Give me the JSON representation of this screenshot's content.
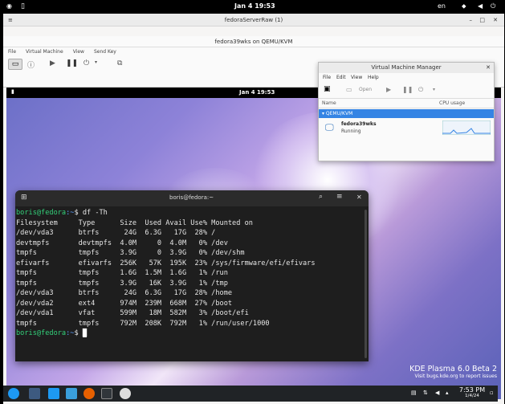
{
  "gnome_bar": {
    "clock": "Jan 4  19:53",
    "title": "fedoraServerRaw (1)",
    "lang": "en"
  },
  "viewer": {
    "window_title": "fedora39wks on QEMU/KVM",
    "menu": [
      "File",
      "Virtual Machine",
      "View",
      "Send Key"
    ]
  },
  "guest": {
    "clock": "Jan 4  19:53"
  },
  "vmm": {
    "title": "Virtual Machine Manager",
    "menu": [
      "File",
      "Edit",
      "View",
      "Help"
    ],
    "open_label": "Open",
    "col_name": "Name",
    "col_cpu": "CPU usage",
    "group": "QEMU/KVM",
    "vm_name": "fedora39wks",
    "vm_status": "Running"
  },
  "terminal": {
    "title": "boris@fedora:~",
    "prompt_user": "boris@fedora",
    "prompt_path": ":~",
    "prompt_symbol": "$ ",
    "command": "df -Th",
    "header": "Filesystem     Type      Size  Used Avail Use% Mounted on",
    "rows": [
      "/dev/vda3      btrfs      24G  6.3G   17G  28% /",
      "devtmpfs       devtmpfs  4.0M     0  4.0M   0% /dev",
      "tmpfs          tmpfs     3.9G     0  3.9G   0% /dev/shm",
      "efivarfs       efivarfs  256K   57K  195K  23% /sys/firmware/efi/efivars",
      "tmpfs          tmpfs     1.6G  1.5M  1.6G   1% /run",
      "tmpfs          tmpfs     3.9G   16K  3.9G   1% /tmp",
      "/dev/vda3      btrfs      24G  6.3G   17G  28% /home",
      "/dev/vda2      ext4      974M  239M  668M  27% /boot",
      "/dev/vda1      vfat      599M   18M  582M   3% /boot/efi",
      "tmpfs          tmpfs     792M  208K  792M   1% /run/user/1000"
    ]
  },
  "kde": {
    "title": "KDE Plasma 6.0 Beta 2",
    "subtitle": "Visit bugs.kde.org to report issues"
  },
  "taskbar": {
    "time": "7:53 PM",
    "date": "1/4/24"
  },
  "colors": {
    "accent": "#3584e4",
    "prompt_user": "#33d17a",
    "terminal_bg": "#1e1e1e"
  }
}
